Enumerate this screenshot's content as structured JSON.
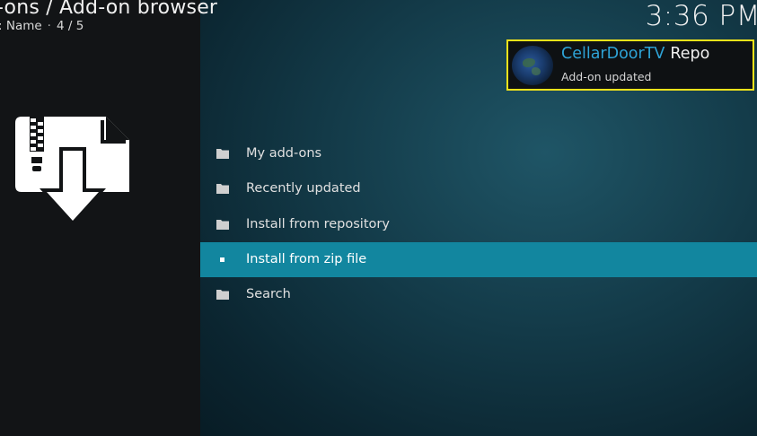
{
  "header": {
    "title": "-ons / Add-on browser",
    "sort_label": ": Name",
    "position": "4 / 5",
    "clock": "3:36 PM"
  },
  "menu": {
    "items": [
      {
        "label": "My add-ons",
        "icon": "folder-icon"
      },
      {
        "label": "Recently updated",
        "icon": "folder-icon"
      },
      {
        "label": "Install from repository",
        "icon": "folder-icon"
      },
      {
        "label": "Install from zip file",
        "icon": "bullet-icon",
        "focused": true
      },
      {
        "label": "Search",
        "icon": "folder-icon"
      }
    ]
  },
  "notification": {
    "title_colored": "CellarDoorTV",
    "title_plain": "Repo",
    "message": "Add-on updated",
    "icon": "globe-icon",
    "border_color": "#f4e31a",
    "title_color": "#2ea3d6"
  },
  "artwork": {
    "icon": "zip-install-icon"
  },
  "colors": {
    "focus_highlight": "#12869f",
    "left_panel": "#121416",
    "main_panel": "#133a48"
  }
}
